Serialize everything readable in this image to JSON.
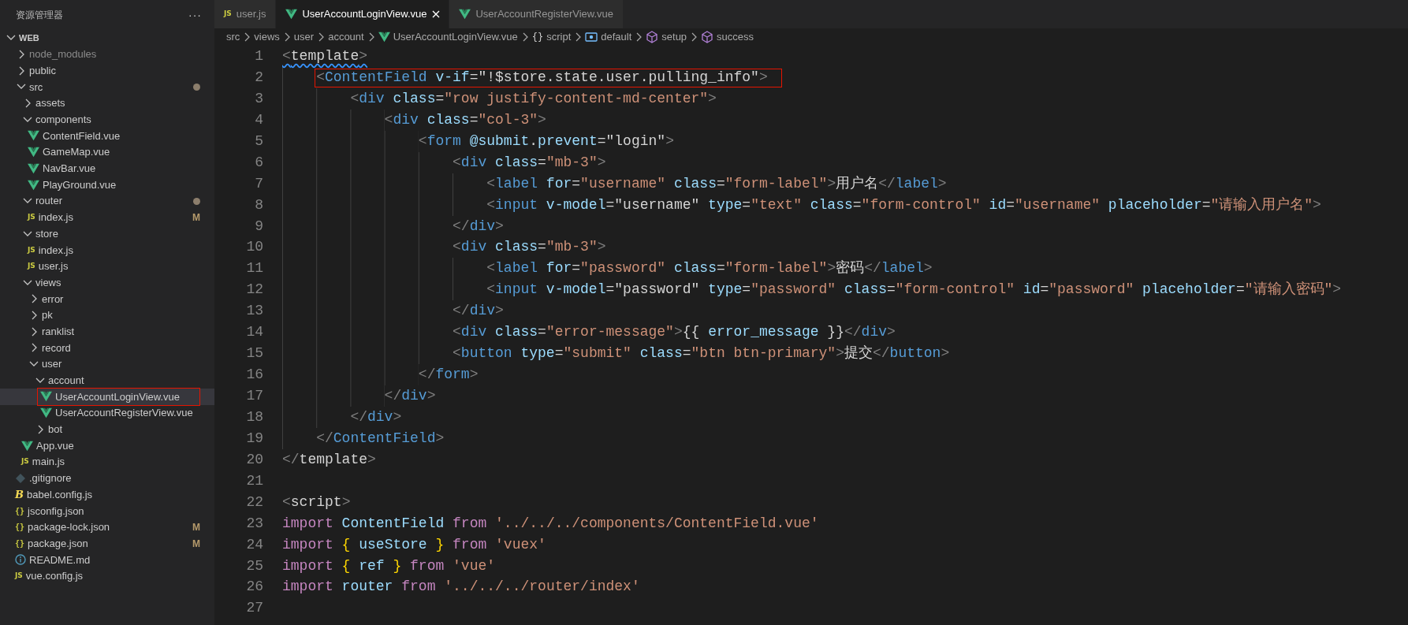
{
  "sidebar": {
    "title": "资源管理器",
    "more": "···",
    "root": {
      "name": "WEB",
      "kind": "folder",
      "expanded": true,
      "selected": false,
      "children": [
        {
          "name": "node_modules",
          "kind": "folder",
          "expanded": false,
          "selected": false,
          "dimmed": true
        },
        {
          "name": "public",
          "kind": "folder",
          "expanded": false,
          "selected": false
        },
        {
          "name": "src",
          "kind": "folder",
          "expanded": true,
          "selected": false,
          "modified_dot": true,
          "children": [
            {
              "name": "assets",
              "kind": "folder",
              "expanded": false,
              "selected": false
            },
            {
              "name": "components",
              "kind": "folder",
              "expanded": true,
              "selected": false,
              "children": [
                {
                  "name": "ContentField.vue",
                  "kind": "vue",
                  "selected": false
                },
                {
                  "name": "GameMap.vue",
                  "kind": "vue",
                  "selected": false
                },
                {
                  "name": "NavBar.vue",
                  "kind": "vue",
                  "selected": false
                },
                {
                  "name": "PlayGround.vue",
                  "kind": "vue",
                  "selected": false
                }
              ]
            },
            {
              "name": "router",
              "kind": "folder",
              "expanded": true,
              "selected": false,
              "modified_dot": true,
              "children": [
                {
                  "name": "index.js",
                  "kind": "js",
                  "icon_text": "JS",
                  "selected": false,
                  "git_status": "M"
                }
              ]
            },
            {
              "name": "store",
              "kind": "folder",
              "expanded": true,
              "selected": false,
              "children": [
                {
                  "name": "index.js",
                  "kind": "js",
                  "icon_text": "JS",
                  "selected": false
                },
                {
                  "name": "user.js",
                  "kind": "js",
                  "icon_text": "JS",
                  "selected": false
                }
              ]
            },
            {
              "name": "views",
              "kind": "folder",
              "expanded": true,
              "selected": false,
              "children": [
                {
                  "name": "error",
                  "kind": "folder",
                  "expanded": false,
                  "selected": false
                },
                {
                  "name": "pk",
                  "kind": "folder",
                  "expanded": false,
                  "selected": false
                },
                {
                  "name": "ranklist",
                  "kind": "folder",
                  "expanded": false,
                  "selected": false
                },
                {
                  "name": "record",
                  "kind": "folder",
                  "expanded": false,
                  "selected": false
                },
                {
                  "name": "user",
                  "kind": "folder",
                  "expanded": true,
                  "selected": false,
                  "children": [
                    {
                      "name": "account",
                      "kind": "folder",
                      "expanded": true,
                      "selected": false,
                      "children": [
                        {
                          "name": "UserAccountLoginView.vue",
                          "kind": "vue",
                          "selected": true,
                          "highlighted": true
                        },
                        {
                          "name": "UserAccountRegisterView.vue",
                          "kind": "vue",
                          "selected": false
                        }
                      ]
                    },
                    {
                      "name": "bot",
                      "kind": "folder",
                      "expanded": false,
                      "selected": false
                    }
                  ]
                }
              ]
            },
            {
              "name": "App.vue",
              "kind": "vue",
              "selected": false
            },
            {
              "name": "main.js",
              "kind": "js",
              "icon_text": "JS",
              "selected": false
            }
          ]
        },
        {
          "name": ".gitignore",
          "kind": "git",
          "selected": false
        },
        {
          "name": "babel.config.js",
          "kind": "babel",
          "icon_text": "B",
          "selected": false
        },
        {
          "name": "jsconfig.json",
          "kind": "json",
          "icon_text": "{}",
          "selected": false
        },
        {
          "name": "package-lock.json",
          "kind": "json",
          "icon_text": "{}",
          "selected": false,
          "git_status": "M"
        },
        {
          "name": "package.json",
          "kind": "json",
          "icon_text": "{}",
          "selected": false,
          "git_status": "M"
        },
        {
          "name": "README.md",
          "kind": "info",
          "selected": false
        },
        {
          "name": "vue.config.js",
          "kind": "js",
          "icon_text": "JS",
          "selected": false
        }
      ]
    }
  },
  "tabs": [
    {
      "label": "user.js",
      "kind": "js",
      "icon_text": "JS",
      "selected": false
    },
    {
      "label": "UserAccountLoginView.vue",
      "kind": "vue",
      "selected": true
    },
    {
      "label": "UserAccountRegisterView.vue",
      "kind": "vue",
      "selected": false
    }
  ],
  "breadcrumbs": [
    {
      "label": "src",
      "kind": "folder"
    },
    {
      "label": "views",
      "kind": "folder"
    },
    {
      "label": "user",
      "kind": "folder"
    },
    {
      "label": "account",
      "kind": "folder"
    },
    {
      "label": "UserAccountLoginView.vue",
      "kind": "vue"
    },
    {
      "label": "script",
      "kind": "braces",
      "icon_text": "{}"
    },
    {
      "label": "default",
      "kind": "module"
    },
    {
      "label": "setup",
      "kind": "cube"
    },
    {
      "label": "success",
      "kind": "cube"
    }
  ],
  "code": [
    {
      "number": "1",
      "squiggle": true,
      "tokens": [
        {
          "kind": "p",
          "text": "<"
        },
        {
          "kind": "plain",
          "text": "template"
        },
        {
          "kind": "p",
          "text": ">"
        }
      ],
      "children": [
        {
          "number": "2",
          "highlighted": true,
          "tokens": [
            {
              "kind": "p",
              "text": "<"
            },
            {
              "kind": "tag",
              "text": "ContentField"
            },
            {
              "kind": "attr",
              "text": " v-if"
            },
            {
              "kind": "plain",
              "text": "=\"!$store.state.user.pulling_info\""
            },
            {
              "kind": "p",
              "text": ">"
            }
          ],
          "children": [
            {
              "number": "3",
              "tokens": [
                {
                  "kind": "p",
                  "text": "<"
                },
                {
                  "kind": "tag",
                  "text": "div"
                },
                {
                  "kind": "attr",
                  "text": " class"
                },
                {
                  "kind": "plain",
                  "text": "="
                },
                {
                  "kind": "str",
                  "text": "\"row justify-content-md-center\""
                },
                {
                  "kind": "p",
                  "text": ">"
                }
              ],
              "children": [
                {
                  "number": "4",
                  "tokens": [
                    {
                      "kind": "p",
                      "text": "<"
                    },
                    {
                      "kind": "tag",
                      "text": "div"
                    },
                    {
                      "kind": "attr",
                      "text": " class"
                    },
                    {
                      "kind": "plain",
                      "text": "="
                    },
                    {
                      "kind": "str",
                      "text": "\"col-3\""
                    },
                    {
                      "kind": "p",
                      "text": ">"
                    }
                  ],
                  "children": [
                    {
                      "number": "5",
                      "tokens": [
                        {
                          "kind": "p",
                          "text": "<"
                        },
                        {
                          "kind": "tag",
                          "text": "form"
                        },
                        {
                          "kind": "attr",
                          "text": " @submit"
                        },
                        {
                          "kind": "plain",
                          "text": "."
                        },
                        {
                          "kind": "attr",
                          "text": "prevent"
                        },
                        {
                          "kind": "plain",
                          "text": "=\"login\""
                        },
                        {
                          "kind": "p",
                          "text": ">"
                        }
                      ],
                      "children": [
                        {
                          "number": "6",
                          "tokens": [
                            {
                              "kind": "p",
                              "text": "<"
                            },
                            {
                              "kind": "tag",
                              "text": "div"
                            },
                            {
                              "kind": "attr",
                              "text": " class"
                            },
                            {
                              "kind": "plain",
                              "text": "="
                            },
                            {
                              "kind": "str",
                              "text": "\"mb-3\""
                            },
                            {
                              "kind": "p",
                              "text": ">"
                            }
                          ],
                          "children": [
                            {
                              "number": "7",
                              "tokens": [
                                {
                                  "kind": "p",
                                  "text": "<"
                                },
                                {
                                  "kind": "tag",
                                  "text": "label"
                                },
                                {
                                  "kind": "attr",
                                  "text": " for"
                                },
                                {
                                  "kind": "plain",
                                  "text": "="
                                },
                                {
                                  "kind": "str",
                                  "text": "\"username\""
                                },
                                {
                                  "kind": "attr",
                                  "text": " class"
                                },
                                {
                                  "kind": "plain",
                                  "text": "="
                                },
                                {
                                  "kind": "str",
                                  "text": "\"form-label\""
                                },
                                {
                                  "kind": "p",
                                  "text": ">"
                                },
                                {
                                  "kind": "plain",
                                  "text": "用户名"
                                },
                                {
                                  "kind": "p",
                                  "text": "</"
                                },
                                {
                                  "kind": "tag",
                                  "text": "label"
                                },
                                {
                                  "kind": "p",
                                  "text": ">"
                                }
                              ]
                            },
                            {
                              "number": "8",
                              "tokens": [
                                {
                                  "kind": "p",
                                  "text": "<"
                                },
                                {
                                  "kind": "tag",
                                  "text": "input"
                                },
                                {
                                  "kind": "attr",
                                  "text": " v-model"
                                },
                                {
                                  "kind": "plain",
                                  "text": "=\"username\""
                                },
                                {
                                  "kind": "attr",
                                  "text": " type"
                                },
                                {
                                  "kind": "plain",
                                  "text": "="
                                },
                                {
                                  "kind": "str",
                                  "text": "\"text\""
                                },
                                {
                                  "kind": "attr",
                                  "text": " class"
                                },
                                {
                                  "kind": "plain",
                                  "text": "="
                                },
                                {
                                  "kind": "str",
                                  "text": "\"form-control\""
                                },
                                {
                                  "kind": "attr",
                                  "text": " id"
                                },
                                {
                                  "kind": "plain",
                                  "text": "="
                                },
                                {
                                  "kind": "str",
                                  "text": "\"username\""
                                },
                                {
                                  "kind": "attr",
                                  "text": " placeholder"
                                },
                                {
                                  "kind": "plain",
                                  "text": "="
                                },
                                {
                                  "kind": "str",
                                  "text": "\"请输入用户名\""
                                },
                                {
                                  "kind": "p",
                                  "text": ">"
                                }
                              ]
                            }
                          ]
                        },
                        {
                          "number": "9",
                          "tokens": [
                            {
                              "kind": "p",
                              "text": "</"
                            },
                            {
                              "kind": "tag",
                              "text": "div"
                            },
                            {
                              "kind": "p",
                              "text": ">"
                            }
                          ]
                        },
                        {
                          "number": "10",
                          "tokens": [
                            {
                              "kind": "p",
                              "text": "<"
                            },
                            {
                              "kind": "tag",
                              "text": "div"
                            },
                            {
                              "kind": "attr",
                              "text": " class"
                            },
                            {
                              "kind": "plain",
                              "text": "="
                            },
                            {
                              "kind": "str",
                              "text": "\"mb-3\""
                            },
                            {
                              "kind": "p",
                              "text": ">"
                            }
                          ],
                          "children": [
                            {
                              "number": "11",
                              "tokens": [
                                {
                                  "kind": "p",
                                  "text": "<"
                                },
                                {
                                  "kind": "tag",
                                  "text": "label"
                                },
                                {
                                  "kind": "attr",
                                  "text": " for"
                                },
                                {
                                  "kind": "plain",
                                  "text": "="
                                },
                                {
                                  "kind": "str",
                                  "text": "\"password\""
                                },
                                {
                                  "kind": "attr",
                                  "text": " class"
                                },
                                {
                                  "kind": "plain",
                                  "text": "="
                                },
                                {
                                  "kind": "str",
                                  "text": "\"form-label\""
                                },
                                {
                                  "kind": "p",
                                  "text": ">"
                                },
                                {
                                  "kind": "plain",
                                  "text": "密码"
                                },
                                {
                                  "kind": "p",
                                  "text": "</"
                                },
                                {
                                  "kind": "tag",
                                  "text": "label"
                                },
                                {
                                  "kind": "p",
                                  "text": ">"
                                }
                              ]
                            },
                            {
                              "number": "12",
                              "tokens": [
                                {
                                  "kind": "p",
                                  "text": "<"
                                },
                                {
                                  "kind": "tag",
                                  "text": "input"
                                },
                                {
                                  "kind": "attr",
                                  "text": " v-model"
                                },
                                {
                                  "kind": "plain",
                                  "text": "=\"password\""
                                },
                                {
                                  "kind": "attr",
                                  "text": " type"
                                },
                                {
                                  "kind": "plain",
                                  "text": "="
                                },
                                {
                                  "kind": "str",
                                  "text": "\"password\""
                                },
                                {
                                  "kind": "attr",
                                  "text": " class"
                                },
                                {
                                  "kind": "plain",
                                  "text": "="
                                },
                                {
                                  "kind": "str",
                                  "text": "\"form-control\""
                                },
                                {
                                  "kind": "attr",
                                  "text": " id"
                                },
                                {
                                  "kind": "plain",
                                  "text": "="
                                },
                                {
                                  "kind": "str",
                                  "text": "\"password\""
                                },
                                {
                                  "kind": "attr",
                                  "text": " placeholder"
                                },
                                {
                                  "kind": "plain",
                                  "text": "="
                                },
                                {
                                  "kind": "str",
                                  "text": "\"请输入密码\""
                                },
                                {
                                  "kind": "p",
                                  "text": ">"
                                }
                              ]
                            }
                          ]
                        },
                        {
                          "number": "13",
                          "tokens": [
                            {
                              "kind": "p",
                              "text": "</"
                            },
                            {
                              "kind": "tag",
                              "text": "div"
                            },
                            {
                              "kind": "p",
                              "text": ">"
                            }
                          ]
                        },
                        {
                          "number": "14",
                          "tokens": [
                            {
                              "kind": "p",
                              "text": "<"
                            },
                            {
                              "kind": "tag",
                              "text": "div"
                            },
                            {
                              "kind": "attr",
                              "text": " class"
                            },
                            {
                              "kind": "plain",
                              "text": "="
                            },
                            {
                              "kind": "str",
                              "text": "\"error-message\""
                            },
                            {
                              "kind": "p",
                              "text": ">"
                            },
                            {
                              "kind": "plain",
                              "text": "{{"
                            },
                            {
                              "kind": "attr",
                              "text": " error_message"
                            },
                            {
                              "kind": "plain",
                              "text": " }}"
                            },
                            {
                              "kind": "p",
                              "text": "</"
                            },
                            {
                              "kind": "tag",
                              "text": "div"
                            },
                            {
                              "kind": "p",
                              "text": ">"
                            }
                          ]
                        },
                        {
                          "number": "15",
                          "tokens": [
                            {
                              "kind": "p",
                              "text": "<"
                            },
                            {
                              "kind": "tag",
                              "text": "button"
                            },
                            {
                              "kind": "attr",
                              "text": " type"
                            },
                            {
                              "kind": "plain",
                              "text": "="
                            },
                            {
                              "kind": "str",
                              "text": "\"submit\""
                            },
                            {
                              "kind": "attr",
                              "text": " class"
                            },
                            {
                              "kind": "plain",
                              "text": "="
                            },
                            {
                              "kind": "str",
                              "text": "\"btn btn-primary\""
                            },
                            {
                              "kind": "p",
                              "text": ">"
                            },
                            {
                              "kind": "plain",
                              "text": "提交"
                            },
                            {
                              "kind": "p",
                              "text": "</"
                            },
                            {
                              "kind": "tag",
                              "text": "button"
                            },
                            {
                              "kind": "p",
                              "text": ">"
                            }
                          ]
                        }
                      ]
                    },
                    {
                      "number": "16",
                      "tokens": [
                        {
                          "kind": "p",
                          "text": "</"
                        },
                        {
                          "kind": "tag",
                          "text": "form"
                        },
                        {
                          "kind": "p",
                          "text": ">"
                        }
                      ]
                    }
                  ]
                },
                {
                  "number": "17",
                  "tokens": [
                    {
                      "kind": "p",
                      "text": "</"
                    },
                    {
                      "kind": "tag",
                      "text": "div"
                    },
                    {
                      "kind": "p",
                      "text": ">"
                    }
                  ]
                }
              ]
            },
            {
              "number": "18",
              "tokens": [
                {
                  "kind": "p",
                  "text": "</"
                },
                {
                  "kind": "tag",
                  "text": "div"
                },
                {
                  "kind": "p",
                  "text": ">"
                }
              ]
            }
          ]
        },
        {
          "number": "19",
          "tokens": [
            {
              "kind": "p",
              "text": "</"
            },
            {
              "kind": "tag",
              "text": "ContentField"
            },
            {
              "kind": "p",
              "text": ">"
            }
          ]
        }
      ]
    },
    {
      "number": "20",
      "tokens": [
        {
          "kind": "p",
          "text": "</"
        },
        {
          "kind": "plain",
          "text": "template"
        },
        {
          "kind": "p",
          "text": ">"
        }
      ]
    },
    {
      "number": "21"
    },
    {
      "number": "22",
      "tokens": [
        {
          "kind": "p",
          "text": "<"
        },
        {
          "kind": "plain",
          "text": "script"
        },
        {
          "kind": "p",
          "text": ">"
        }
      ]
    },
    {
      "number": "23",
      "tokens": [
        {
          "kind": "kw",
          "text": "import"
        },
        {
          "kind": "attr",
          "text": " ContentField"
        },
        {
          "kind": "kw",
          "text": " from"
        },
        {
          "kind": "str",
          "text": " '../../../components/ContentField.vue'"
        }
      ]
    },
    {
      "number": "24",
      "tokens": [
        {
          "kind": "kw",
          "text": "import"
        },
        {
          "kind": "brace",
          "text": " {"
        },
        {
          "kind": "attr",
          "text": " useStore"
        },
        {
          "kind": "brace",
          "text": " }"
        },
        {
          "kind": "kw",
          "text": " from"
        },
        {
          "kind": "str",
          "text": " 'vuex'"
        }
      ]
    },
    {
      "number": "25",
      "tokens": [
        {
          "kind": "kw",
          "text": "import"
        },
        {
          "kind": "brace",
          "text": " {"
        },
        {
          "kind": "attr",
          "text": " ref"
        },
        {
          "kind": "brace",
          "text": " }"
        },
        {
          "kind": "kw",
          "text": " from"
        },
        {
          "kind": "str",
          "text": " 'vue'"
        }
      ]
    },
    {
      "number": "26",
      "tokens": [
        {
          "kind": "kw",
          "text": "import"
        },
        {
          "kind": "attr",
          "text": " router"
        },
        {
          "kind": "kw",
          "text": " from"
        },
        {
          "kind": "str",
          "text": " '../../../router/index'"
        }
      ]
    },
    {
      "number": "27"
    }
  ]
}
